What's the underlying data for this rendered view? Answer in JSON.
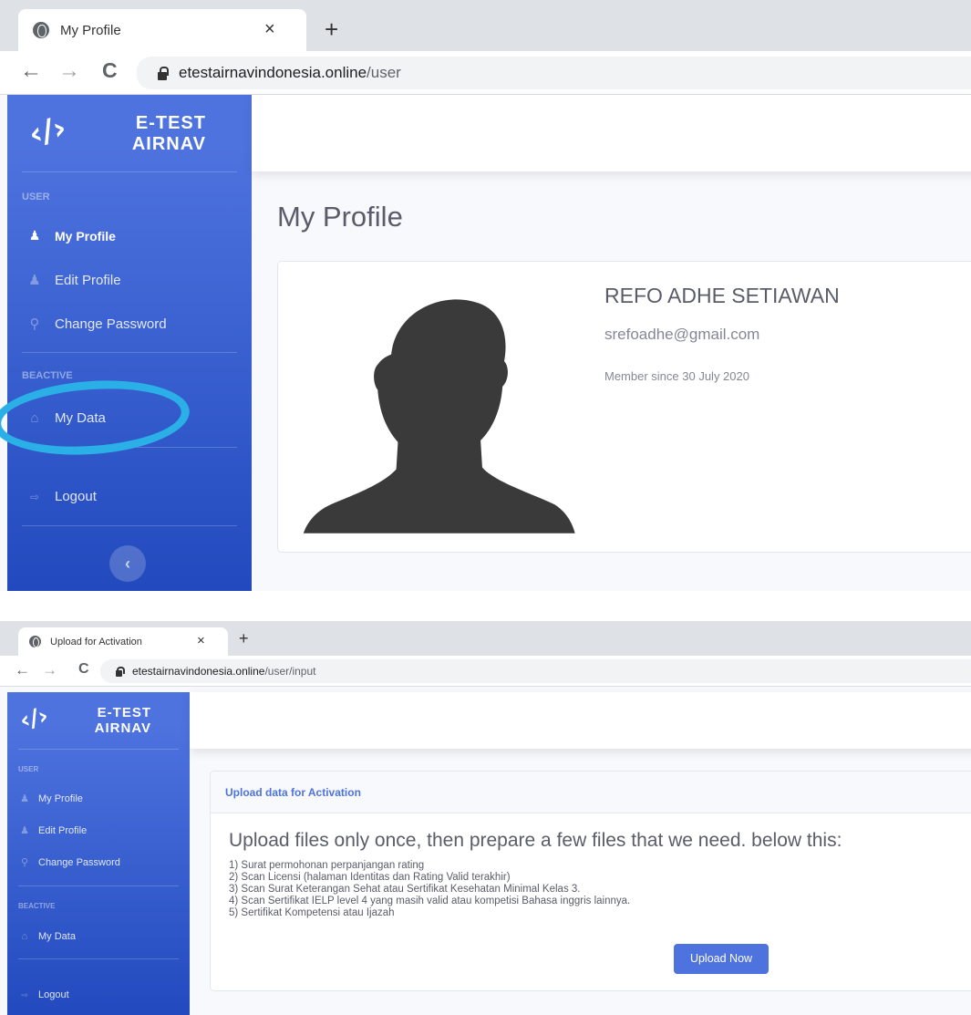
{
  "screens": [
    {
      "tab_title": "My Profile",
      "url_host": "etestairnavindonesia.online",
      "url_path": "/user",
      "brand": {
        "line1": "E-TEST",
        "line2": "AIRNAV"
      },
      "sidebar": {
        "heading_user": "USER",
        "items": [
          {
            "label": "My Profile",
            "active": true
          },
          {
            "label": "Edit Profile"
          },
          {
            "label": "Change Password"
          }
        ],
        "heading_beactive": "BEACTIVE",
        "my_data": "My Data",
        "logout": "Logout",
        "toggle_glyph": "‹"
      },
      "page_title": "My Profile",
      "profile": {
        "name": "REFO ADHE SETIAWAN",
        "email": "srefoadhe@gmail.com",
        "member_since": "Member since 30 July 2020"
      }
    },
    {
      "tab_title": "Upload for Activation",
      "url_host": "etestairnavindonesia.online",
      "url_path": "/user/input",
      "brand": {
        "line1": "E-TEST",
        "line2": "AIRNAV"
      },
      "sidebar": {
        "heading_user": "USER",
        "items": [
          {
            "label": "My Profile"
          },
          {
            "label": "Edit Profile"
          },
          {
            "label": "Change Password"
          }
        ],
        "heading_beactive": "BEACTIVE",
        "my_data": "My Data",
        "logout": "Logout"
      },
      "upload": {
        "card_title": "Upload data for Activation",
        "lead": "Upload files only once, then prepare a few files that we need. below this:",
        "requirements": [
          "1) Surat permohonan perpanjangan rating",
          "2) Scan Licensi (halaman Identitas dan Rating Valid terakhir)",
          "3) Scan Surat Keterangan Sehat atau Sertifikat Kesehatan Minimal Kelas 3.",
          "4) Scan Sertifikat IELP level 4 yang masih valid atau kompetisi Bahasa inggris lainnya.",
          "5) Sertifikat Kompetensi atau Ijazah"
        ],
        "button": "Upload Now"
      }
    }
  ],
  "icons": {
    "tab_favicon": "globe-icon",
    "tab_close": "×",
    "new_tab": "+",
    "back": "←",
    "forward": "→",
    "reload": "C",
    "logo": "code-brackets-icon",
    "user": "user-icon",
    "edit_user": "user-edit-icon",
    "key": "key-icon",
    "home": "home-icon",
    "logout": "sign-out-icon"
  },
  "colors": {
    "sidebar_top": "#4e73df",
    "sidebar_bottom": "#224abe",
    "highlight_circle": "#2ab0e6",
    "button": "#4e73df",
    "text_dark": "#5a5c69"
  }
}
